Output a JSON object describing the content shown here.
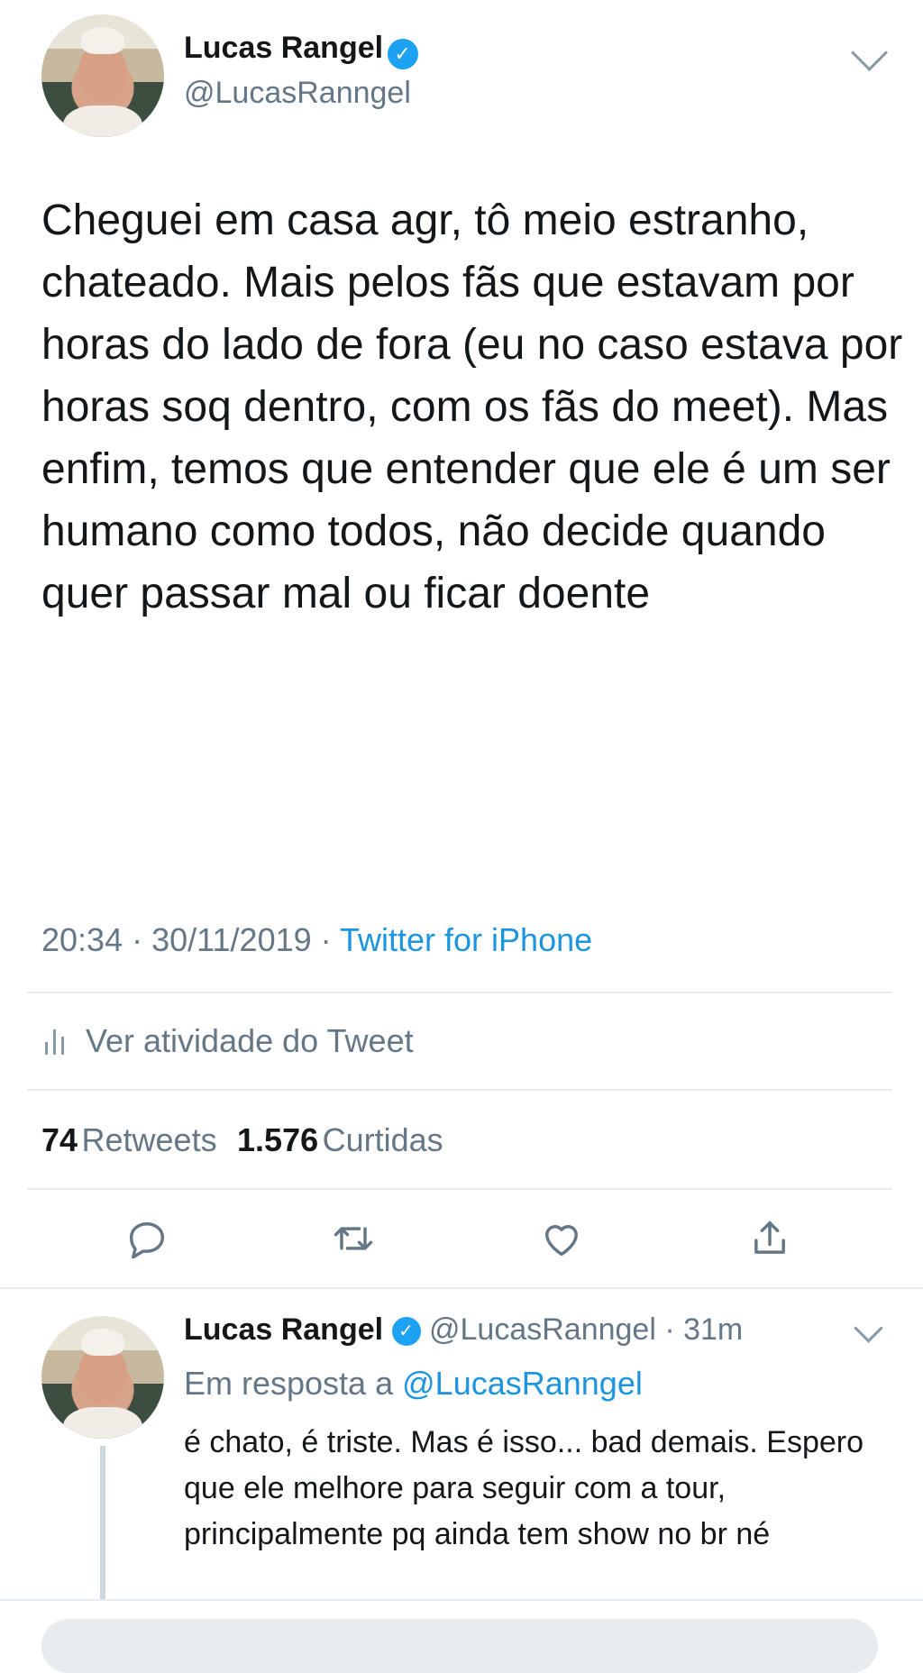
{
  "main_tweet": {
    "author": {
      "name": "Lucas Rangel",
      "handle": "@LucasRanngel",
      "verified_icon": "verified-badge-icon"
    },
    "text": "Cheguei em casa agr, tô meio estranho, chateado. Mais pelos fãs que estavam por horas do lado de fora (eu no caso estava por horas soq dentro, com os fãs do meet). Mas enfim, temos que entender que ele é um ser humano como todos, não decide quando quer passar mal ou ficar doente",
    "time": "20:34",
    "date": "30/11/2019",
    "separator": "·",
    "source": "Twitter for iPhone",
    "activity_label": "Ver atividade do Tweet",
    "stats": {
      "retweets_count": "74",
      "retweets_label": "Retweets",
      "likes_count": "1.576",
      "likes_label": "Curtidas"
    },
    "actions": [
      "reply-icon",
      "retweet-icon",
      "like-icon",
      "share-icon"
    ]
  },
  "reply_tweet": {
    "author": {
      "name": "Lucas Rangel",
      "handle": "@LucasRanngel",
      "time_ago": "· 31m"
    },
    "reply_prefix": "Em resposta a",
    "reply_to": "@LucasRanngel",
    "text": "é chato, é triste. Mas é isso... bad demais. Espero que ele melhore para seguir com a tour, principalmente pq ainda tem show no br né"
  },
  "colors": {
    "accent": "#1da1f2",
    "link": "#1b95e0",
    "secondary_text": "#657786",
    "divider": "#e6ecf0"
  }
}
